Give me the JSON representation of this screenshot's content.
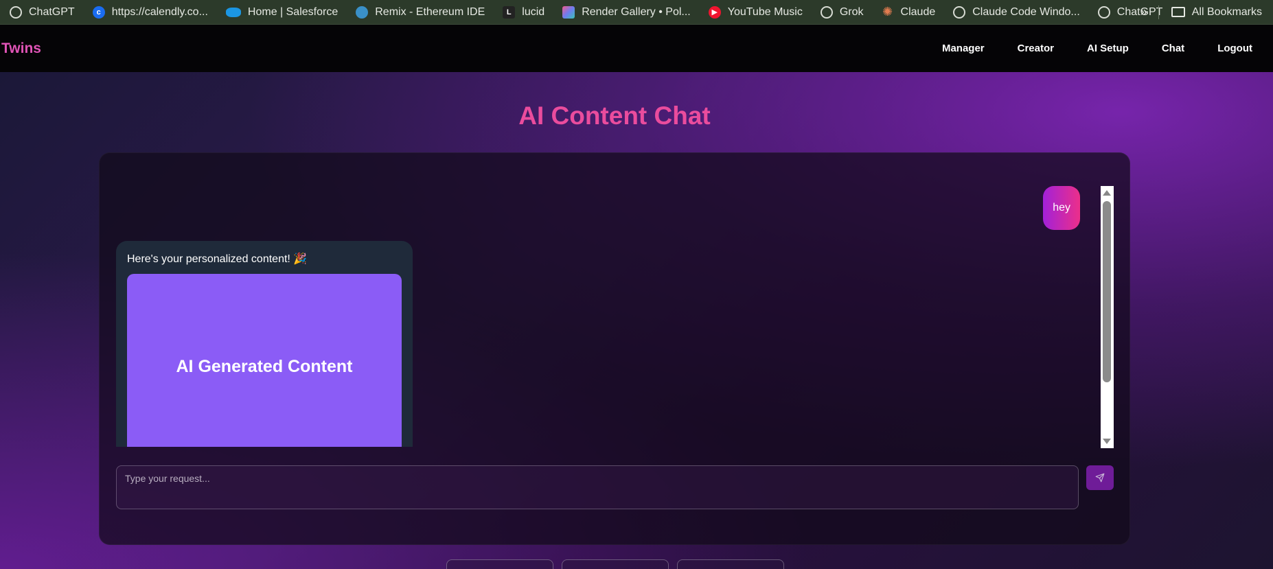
{
  "bookmarks": {
    "items": [
      {
        "label": "ChatGPT",
        "icon": "chatgpt-icon"
      },
      {
        "label": "https://calendly.co...",
        "icon": "calendly-icon"
      },
      {
        "label": "Home | Salesforce",
        "icon": "salesforce-icon"
      },
      {
        "label": "Remix - Ethereum IDE",
        "icon": "remix-icon"
      },
      {
        "label": "lucid",
        "icon": "lucid-icon"
      },
      {
        "label": "Render Gallery • Pol...",
        "icon": "render-icon"
      },
      {
        "label": "YouTube Music",
        "icon": "youtube-music-icon"
      },
      {
        "label": "Grok",
        "icon": "grok-icon"
      },
      {
        "label": "Claude",
        "icon": "claude-icon"
      },
      {
        "label": "Claude Code Windo...",
        "icon": "chatgpt-icon"
      },
      {
        "label": "ChatGPT",
        "icon": "chatgpt-icon"
      }
    ],
    "overflow": "»",
    "all_bookmarks": "All Bookmarks"
  },
  "navbar": {
    "brand": "Twins",
    "links": [
      "Manager",
      "Creator",
      "AI Setup",
      "Chat",
      "Logout"
    ]
  },
  "page": {
    "title": "AI Content Chat"
  },
  "chat": {
    "user_message": "hey",
    "ai_message": "Here's your personalized content! 🎉",
    "ai_image_label": "AI Generated Content",
    "input_placeholder": "Type your request...",
    "input_value": ""
  },
  "colors": {
    "brand": "#e054b6",
    "title": "#ea4c9d",
    "user_bubble_start": "#a221d8",
    "user_bubble_end": "#ec2f8a",
    "ai_bubble": "#1f2a3a",
    "ai_image": "#8b5cf6",
    "send_button": "#6f1c98"
  }
}
